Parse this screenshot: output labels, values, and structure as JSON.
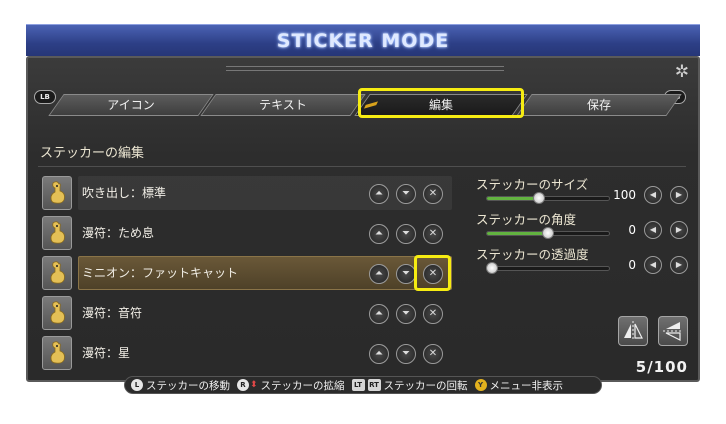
{
  "title": "STICKER MODE",
  "tabs": [
    {
      "label": "アイコン",
      "active": false
    },
    {
      "label": "テキスト",
      "active": false
    },
    {
      "label": "編集",
      "active": true
    },
    {
      "label": "保存",
      "active": false
    }
  ],
  "bumpers": {
    "left": "LB",
    "right": "RB"
  },
  "section_title": "ステッカーの編集",
  "stickers": [
    {
      "name": "吹き出し：標準",
      "selected": false
    },
    {
      "name": "漫符：ため息",
      "selected": false
    },
    {
      "name": "ミニオン：ファットキャット",
      "selected": true
    },
    {
      "name": "漫符：音符",
      "selected": false
    },
    {
      "name": "漫符：星",
      "selected": false
    }
  ],
  "settings": [
    {
      "label": "ステッカーのサイズ",
      "value": "100",
      "level": 0.43
    },
    {
      "label": "ステッカーの角度",
      "value": "0",
      "level": 0.5
    },
    {
      "label": "ステッカーの透過度",
      "value": "0",
      "level": 0.0
    }
  ],
  "count": "5/100",
  "hints": {
    "l_button": "L",
    "move": "ステッカーの移動",
    "r_button": "R",
    "scale": "ステッカーの拡縮",
    "lt": "LT",
    "rt": "RT",
    "rotate": "ステッカーの回転",
    "y_button": "Y",
    "hide_menu": "メニュー非表示"
  },
  "colors": {
    "highlight": "#f6ec12",
    "title_banner": "#2d3f86",
    "slider_fill": "#62b340",
    "selected_row": "#6a5838"
  },
  "icons": {
    "sticker_thumb": "chocobo-icon",
    "up": "up-arrow-icon",
    "down": "down-arrow-icon",
    "delete": "x-icon",
    "settings": "gear-icon"
  }
}
